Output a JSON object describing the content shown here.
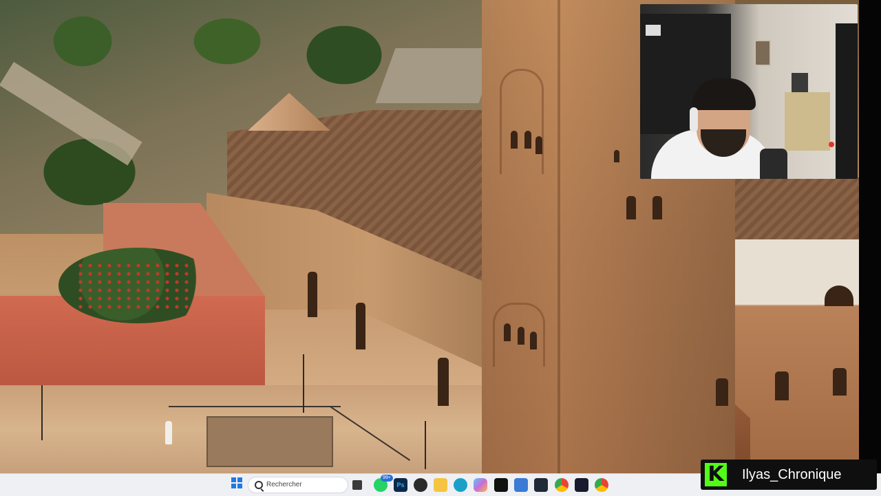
{
  "video": {
    "scene": "koutoubia-mosque-aerial"
  },
  "taskbar": {
    "search_placeholder": "Rechercher",
    "whatsapp_badge": "99+",
    "icons": [
      "windows-start-icon",
      "search-icon",
      "task-view-icon",
      "whatsapp-icon",
      "photoshop-icon",
      "obs-icon",
      "file-explorer-icon",
      "edge-icon",
      "copilot-icon",
      "capcut-icon",
      "snipping-tool-icon",
      "davinci-resolve-icon",
      "chrome-icon",
      "premiere-icon",
      "chrome-2-icon"
    ]
  },
  "stream": {
    "platform_logo": "kick-icon",
    "logo_letter": "K",
    "username": "Ilyas_Chronique",
    "accent": "#53fc18"
  },
  "colors": {
    "taskbar_bg": "#eef0f4",
    "banner_bg": "#0f0f0f"
  }
}
